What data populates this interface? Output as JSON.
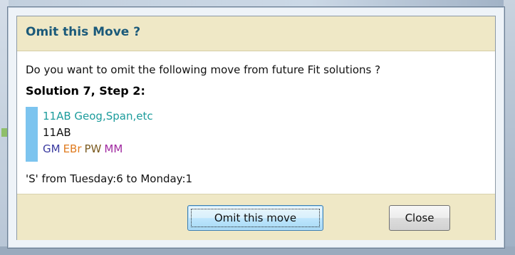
{
  "dialog": {
    "title": "Omit this Move ?",
    "question": "Do you want to omit the following move from future Fit solutions ?",
    "solution_heading": "Solution 7, Step 2:",
    "move": {
      "class_line": "11AB Geog,Span,etc",
      "group_line": "11AB",
      "teachers": [
        {
          "code": "GM",
          "color": "#3a3aa0"
        },
        {
          "code": "EBr",
          "color": "#e07b1f"
        },
        {
          "code": "PW",
          "color": "#7a5a20"
        },
        {
          "code": "MM",
          "color": "#a02aa0"
        }
      ],
      "bar_color": "#7cc4ef"
    },
    "move_description": "'S'  from Tuesday:6 to Monday:1",
    "buttons": {
      "omit_label": "Omit this move",
      "close_label": "Close"
    }
  },
  "colors": {
    "title_text": "#1b5a7a",
    "panel_background": "#efe8c6",
    "class_line_text": "#1c9c9c"
  }
}
